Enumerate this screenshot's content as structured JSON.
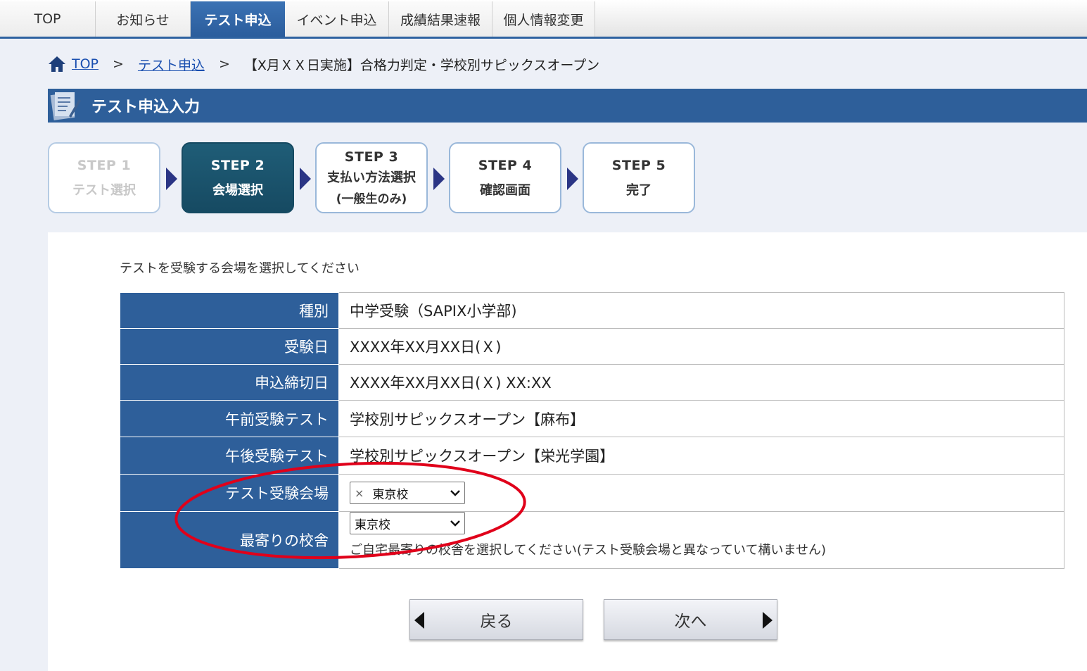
{
  "nav": {
    "tabs": [
      {
        "label": "TOP",
        "active": false
      },
      {
        "label": "お知らせ",
        "active": false
      },
      {
        "label": "テスト申込",
        "active": true
      },
      {
        "label": "イベント申込",
        "active": false
      },
      {
        "label": "成績結果速報",
        "active": false
      },
      {
        "label": "個人情報変更",
        "active": false
      }
    ]
  },
  "breadcrumb": {
    "home": "TOP",
    "parent": "テスト申込",
    "current": "【X月ＸＸ日実施】合格力判定・学校別サピックスオープン",
    "separator": ">"
  },
  "section": {
    "title": "テスト申込入力"
  },
  "steps": [
    {
      "num": "STEP 1",
      "label": "テスト選択",
      "sub": "",
      "state": "done"
    },
    {
      "num": "STEP 2",
      "label": "会場選択",
      "sub": "",
      "state": "current"
    },
    {
      "num": "STEP 3",
      "label": "支払い方法選択",
      "sub": "(一般生のみ)",
      "state": "upcoming"
    },
    {
      "num": "STEP 4",
      "label": "確認画面",
      "sub": "",
      "state": "upcoming"
    },
    {
      "num": "STEP 5",
      "label": "完了",
      "sub": "",
      "state": "upcoming"
    }
  ],
  "form": {
    "instruction": "テストを受験する会場を選択してください",
    "rows": {
      "type_label": "種別",
      "type_value": "中学受験（SAPIX小学部)",
      "date_label": "受験日",
      "date_value": "XXXX年XX月XX日(Ｘ)",
      "deadline_label": "申込締切日",
      "deadline_value": "XXXX年XX月XX日(Ｘ) XX:XX",
      "am_label": "午前受験テスト",
      "am_value": "学校別サピックスオープン【麻布】",
      "pm_label": "午後受験テスト",
      "pm_value": "学校別サピックスオープン【栄光学園】",
      "venue_label": "テスト受験会場",
      "venue_mark": "×",
      "venue_value": "東京校",
      "nearest_label": "最寄りの校舎",
      "nearest_value": "東京校",
      "nearest_note": "ご自宅最寄りの校舎を選択してください(テスト受験会場と異なっていて構いません)"
    }
  },
  "buttons": {
    "back": "戻る",
    "next": "次へ"
  },
  "colors": {
    "primary_blue": "#2e5f9a",
    "current_step": "#1a5470",
    "step_arrow": "#2b3585",
    "annotation": "#e0001a",
    "link": "#1a4fb0"
  }
}
